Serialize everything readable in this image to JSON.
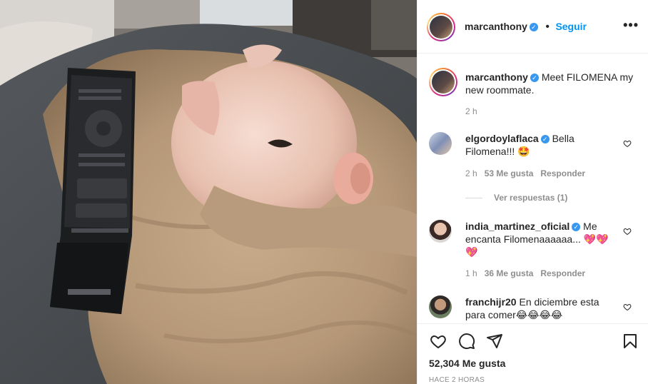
{
  "post": {
    "author": "marcanthony",
    "verified": true,
    "follow_label": "Seguir",
    "more_icon": "more-options-icon",
    "caption_user": "marcanthony",
    "caption_text": "Meet FILOMENA my new roommate.",
    "caption_time": "2 h"
  },
  "comments": [
    {
      "user": "elgordoylaflaca",
      "verified": true,
      "text": "Bella Filomena!!! 🤩",
      "time": "2 h",
      "likes": "53 Me gusta",
      "reply": "Responder",
      "view_replies": "Ver respuestas (1)"
    },
    {
      "user": "india_martinez_oficial",
      "verified": true,
      "text": "Me encanta Filomenaaaaaa... 💖💖💖",
      "time": "1 h",
      "likes": "36 Me gusta",
      "reply": "Responder"
    },
    {
      "user": "franchijr20",
      "verified": false,
      "text": "En diciembre esta para comer😂😂😂😂"
    }
  ],
  "actions": {
    "icons": [
      "like-icon",
      "comment-icon",
      "share-icon",
      "save-icon"
    ],
    "likes_count": "52,304 Me gusta",
    "posted_ago": "HACE 2 HORAS"
  },
  "colors": {
    "follow": "#0095f6",
    "verified": "#3897f0",
    "muted": "#8e8e8e"
  }
}
